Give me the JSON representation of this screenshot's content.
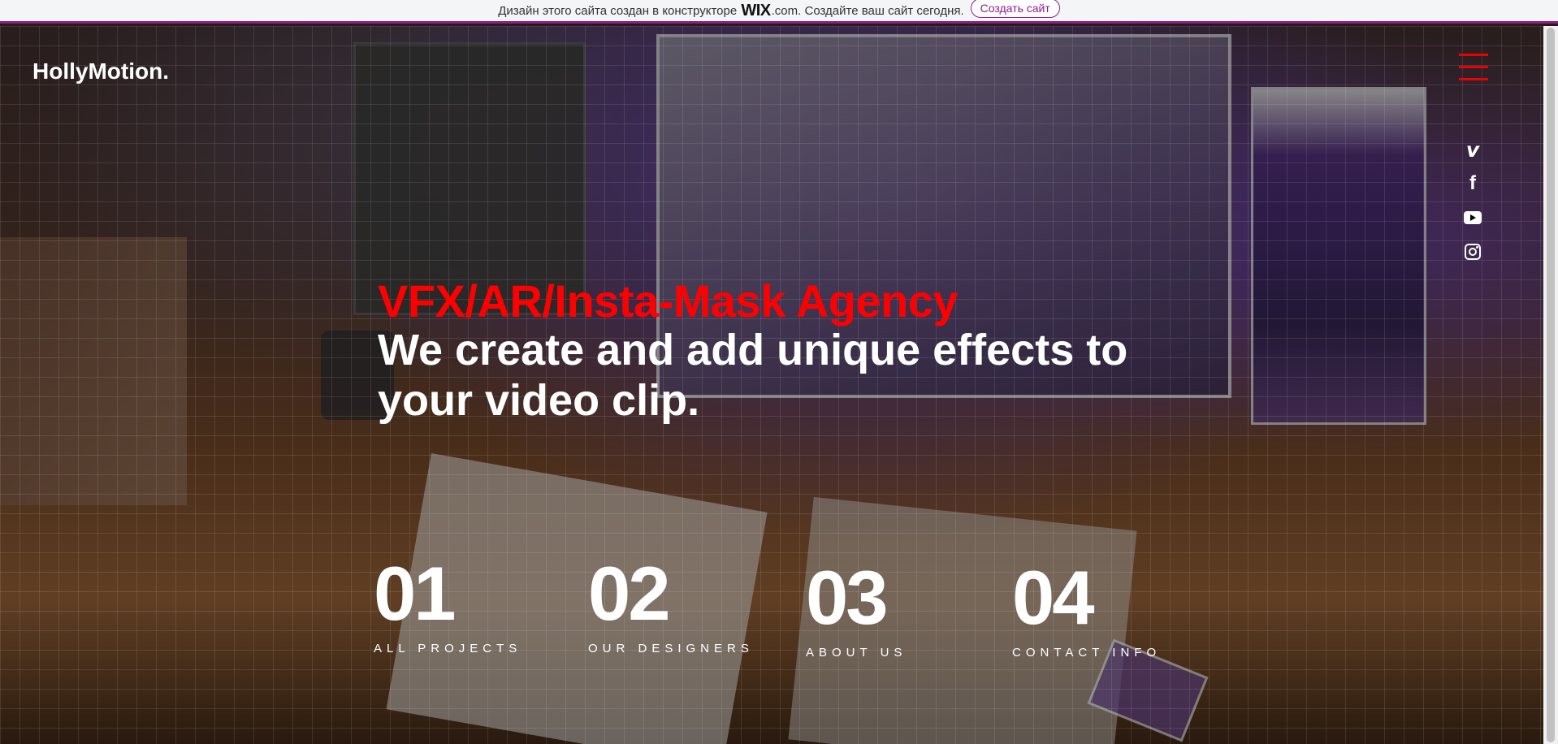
{
  "wix_banner": {
    "text_before": "Дизайн этого сайта создан в конструкторе",
    "wix_logo": "WIX",
    "text_after": ".com. Создайте ваш сайт сегодня.",
    "cta": "Создать сайт"
  },
  "header": {
    "logo": "HollyMotion."
  },
  "social": {
    "vimeo": "v",
    "facebook": "f"
  },
  "hero": {
    "tagline": "VFX/AR/Insta-Mask Agency",
    "headline": "We create and add unique effects to your video clip."
  },
  "nav": [
    {
      "number": "01",
      "label": "ALL PROJECTS"
    },
    {
      "number": "02",
      "label": "OUR DESIGNERS"
    },
    {
      "number": "03",
      "label": "ABOUT US"
    },
    {
      "number": "04",
      "label": "CONTACT INFO"
    }
  ],
  "colors": {
    "accent": "#ff0000",
    "banner_border": "#8c1e8f",
    "text": "#ffffff"
  }
}
